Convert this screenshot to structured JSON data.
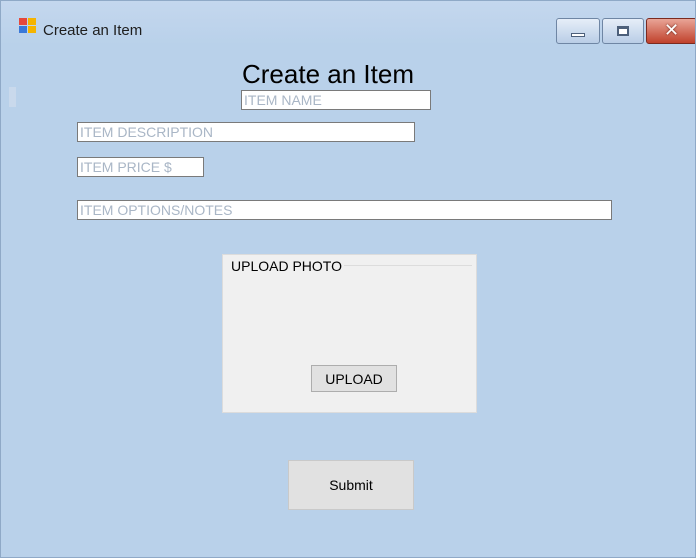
{
  "window": {
    "title": "Create an Item",
    "close_glyph": "✕",
    "icon": "app-window-icon"
  },
  "form": {
    "heading": "Create an Item",
    "item_name": {
      "value": "",
      "placeholder": "ITEM NAME"
    },
    "item_description": {
      "value": "",
      "placeholder": "ITEM DESCRIPTION"
    },
    "item_price": {
      "value": "",
      "placeholder": "ITEM PRICE $"
    },
    "item_notes": {
      "value": "",
      "placeholder": "ITEM OPTIONS/NOTES"
    },
    "upload_group_label": "UPLOAD PHOTO",
    "upload_button_label": "UPLOAD",
    "submit_button_label": "Submit"
  },
  "colors": {
    "window_background": "#b9d1ea",
    "panel_background": "#f0f0f0",
    "button_background": "#e1e1e1",
    "close_button": "#c0412c"
  }
}
